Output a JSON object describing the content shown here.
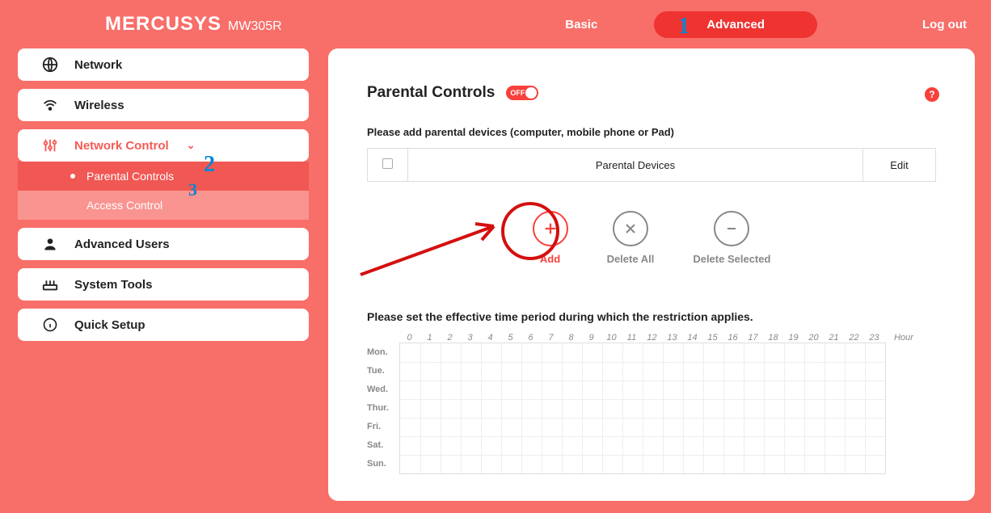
{
  "brand": {
    "name": "MERCUSYS",
    "model": "MW305R"
  },
  "nav": {
    "basic": "Basic",
    "advanced": "Advanced",
    "logout": "Log out"
  },
  "sidebar": {
    "network": "Network",
    "wireless": "Wireless",
    "network_control": "Network Control",
    "sub": {
      "parental": "Parental Controls",
      "access": "Access Control"
    },
    "advanced_users": "Advanced Users",
    "system_tools": "System Tools",
    "quick_setup": "Quick Setup"
  },
  "page": {
    "title": "Parental Controls",
    "toggle_state": "OFF",
    "help": "?",
    "instruction1": "Please add parental devices (computer, mobile phone or Pad)",
    "table": {
      "col_devices": "Parental Devices",
      "col_edit": "Edit"
    },
    "actions": {
      "add": "Add",
      "delete_all": "Delete All",
      "delete_selected": "Delete Selected"
    },
    "instruction2": "Please set the effective time period during which the restriction applies.",
    "hours": [
      "0",
      "1",
      "2",
      "3",
      "4",
      "5",
      "6",
      "7",
      "8",
      "9",
      "10",
      "11",
      "12",
      "13",
      "14",
      "15",
      "16",
      "17",
      "18",
      "19",
      "20",
      "21",
      "22",
      "23"
    ],
    "hour_label": "Hour",
    "days": [
      "Mon.",
      "Tue.",
      "Wed.",
      "Thur.",
      "Fri.",
      "Sat.",
      "Sun."
    ]
  },
  "annotations": {
    "n1": "1",
    "n2": "2",
    "n3": "3"
  }
}
